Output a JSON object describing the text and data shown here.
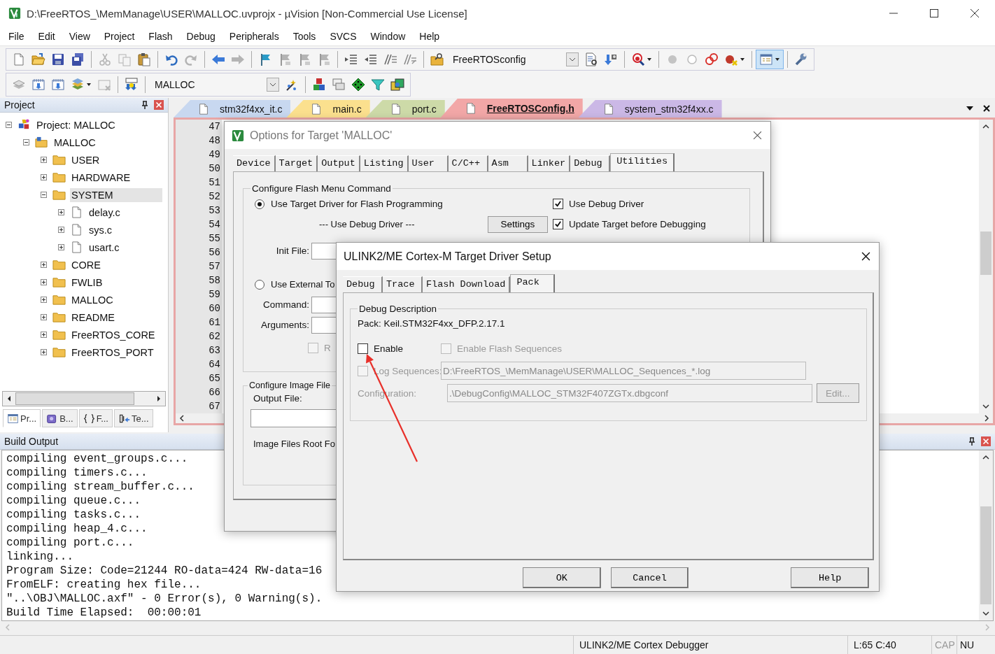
{
  "window": {
    "title": "D:\\FreeRTOS_\\MemManage\\USER\\MALLOC.uvprojx - µVision  [Non-Commercial Use License]"
  },
  "menu": [
    "File",
    "Edit",
    "View",
    "Project",
    "Flash",
    "Debug",
    "Peripherals",
    "Tools",
    "SVCS",
    "Window",
    "Help"
  ],
  "toolbar": {
    "config_combo": "FreeRTOSconfig"
  },
  "build_toolbar": {
    "target_combo": "MALLOC"
  },
  "project_panel": {
    "title": "Project",
    "tree": [
      {
        "label": "Project: MALLOC",
        "kind": "project",
        "expanded": true,
        "selected": false,
        "children": [
          {
            "label": "MALLOC",
            "kind": "target",
            "expanded": true,
            "selected": false,
            "children": [
              {
                "label": "USER",
                "kind": "folder",
                "expanded": false,
                "selected": false
              },
              {
                "label": "HARDWARE",
                "kind": "folder",
                "expanded": false,
                "selected": false
              },
              {
                "label": "SYSTEM",
                "kind": "folder",
                "expanded": true,
                "selected": true,
                "children": [
                  {
                    "label": "delay.c",
                    "kind": "file",
                    "expanded": false,
                    "selected": false
                  },
                  {
                    "label": "sys.c",
                    "kind": "file",
                    "expanded": false,
                    "selected": false
                  },
                  {
                    "label": "usart.c",
                    "kind": "file",
                    "expanded": false,
                    "selected": false
                  }
                ]
              },
              {
                "label": "CORE",
                "kind": "folder",
                "expanded": false,
                "selected": false
              },
              {
                "label": "FWLIB",
                "kind": "folder",
                "expanded": false,
                "selected": false
              },
              {
                "label": "MALLOC",
                "kind": "folder",
                "expanded": false,
                "selected": false
              },
              {
                "label": "README",
                "kind": "folder",
                "expanded": false,
                "selected": false
              },
              {
                "label": "FreeRTOS_CORE",
                "kind": "folder",
                "expanded": false,
                "selected": false
              },
              {
                "label": "FreeRTOS_PORT",
                "kind": "folder",
                "expanded": false,
                "selected": false
              }
            ]
          }
        ]
      }
    ],
    "tabs": [
      {
        "label": "Pr...",
        "kind": "project",
        "selected": true
      },
      {
        "label": "B...",
        "kind": "books",
        "selected": false
      },
      {
        "label": "F...",
        "kind": "functions",
        "selected": false
      },
      {
        "label": "Te...",
        "kind": "templates",
        "selected": false
      }
    ]
  },
  "editor": {
    "tabs": [
      {
        "label": "stm32f4xx_it.c",
        "color": "#c8d8f0",
        "selected": false
      },
      {
        "label": "main.c",
        "color": "#fbe08e",
        "selected": false
      },
      {
        "label": "port.c",
        "color": "#cddaa8",
        "selected": false
      },
      {
        "label": "FreeRTOSConfig.h",
        "color": "#f2a7a7",
        "selected": true
      },
      {
        "label": "system_stm32f4xx.c",
        "color": "#cbb8e6",
        "selected": false
      }
    ],
    "line_numbers": [
      "47",
      "48",
      "49",
      "50",
      "51",
      "52",
      "53",
      "54",
      "55",
      "56",
      "57",
      "58",
      "59",
      "60",
      "61",
      "62",
      "63",
      "64",
      "65",
      "66",
      "67"
    ]
  },
  "build_output": {
    "title": "Build Output",
    "lines": [
      "compiling event_groups.c...",
      "compiling timers.c...",
      "compiling stream_buffer.c...",
      "compiling queue.c...",
      "compiling tasks.c...",
      "compiling heap_4.c...",
      "compiling port.c...",
      "linking...",
      "Program Size: Code=21244 RO-data=424 RW-data=16",
      "FromELF: creating hex file...",
      "\"..\\OBJ\\MALLOC.axf\" - 0 Error(s), 0 Warning(s).",
      "Build Time Elapsed:  00:00:01"
    ]
  },
  "options_dialog": {
    "title": "Options for Target 'MALLOC'",
    "tabs": [
      {
        "label": "Device",
        "selected": false
      },
      {
        "label": "Target",
        "selected": false
      },
      {
        "label": "Output",
        "selected": false
      },
      {
        "label": "Listing",
        "selected": false
      },
      {
        "label": "User",
        "selected": false
      },
      {
        "label": "C/C++",
        "selected": false
      },
      {
        "label": "Asm",
        "selected": false
      },
      {
        "label": "Linker",
        "selected": false
      },
      {
        "label": "Debug",
        "selected": false
      },
      {
        "label": "Utilities",
        "selected": true
      }
    ],
    "flash_group": {
      "title": "Configure Flash Menu Command",
      "target_driver": {
        "label": "Use Target Driver for Flash Programming",
        "selected": true
      },
      "driver_caption": "--- Use Debug Driver ---",
      "settings_button": "Settings",
      "use_debug_driver": {
        "label": "Use Debug Driver",
        "checked": true
      },
      "update_target": {
        "label": "Update Target before Debugging",
        "checked": true
      },
      "init_file_label": "Init File:",
      "external_tool": {
        "label": "Use External To",
        "selected": false
      },
      "command_label": "Command:",
      "arguments_label": "Arguments:",
      "run_checkbox": {
        "label": "R",
        "checked": false,
        "disabled": true
      }
    },
    "image_group": {
      "title": "Configure Image File",
      "output_file_label": "Output File:",
      "root_folder_label": "Image Files Root Fo"
    }
  },
  "driver_dialog": {
    "title": "ULINK2/ME Cortex-M Target Driver Setup",
    "tabs": [
      {
        "label": "Debug",
        "selected": false
      },
      {
        "label": "Trace",
        "selected": false
      },
      {
        "label": "Flash Download",
        "selected": false
      },
      {
        "label": "Pack",
        "selected": true
      }
    ],
    "group_title": "Debug Description",
    "pack": "Pack:  Keil.STM32F4xx_DFP.2.17.1",
    "enable": {
      "label": "Enable",
      "checked": false,
      "disabled": false
    },
    "flash_sequences": {
      "label": "Enable Flash Sequences",
      "checked": false,
      "disabled": true
    },
    "log_sequences": {
      "label": "Log Sequences:",
      "checked": false,
      "disabled": true,
      "value": "D:\\FreeRTOS_\\MemManage\\USER\\MALLOC_Sequences_*.log"
    },
    "configuration": {
      "label": "Configuration:",
      "disabled": true,
      "value": ".\\DebugConfig\\MALLOC_STM32F407ZGTx.dbgconf"
    },
    "edit_button": {
      "label": "Edit...",
      "disabled": true
    },
    "buttons": [
      "OK",
      "Cancel",
      "Help"
    ]
  },
  "status_bar": {
    "debugger": "ULINK2/ME Cortex Debugger",
    "position": "L:65 C:40",
    "caps": "CAP",
    "num": "NU"
  }
}
